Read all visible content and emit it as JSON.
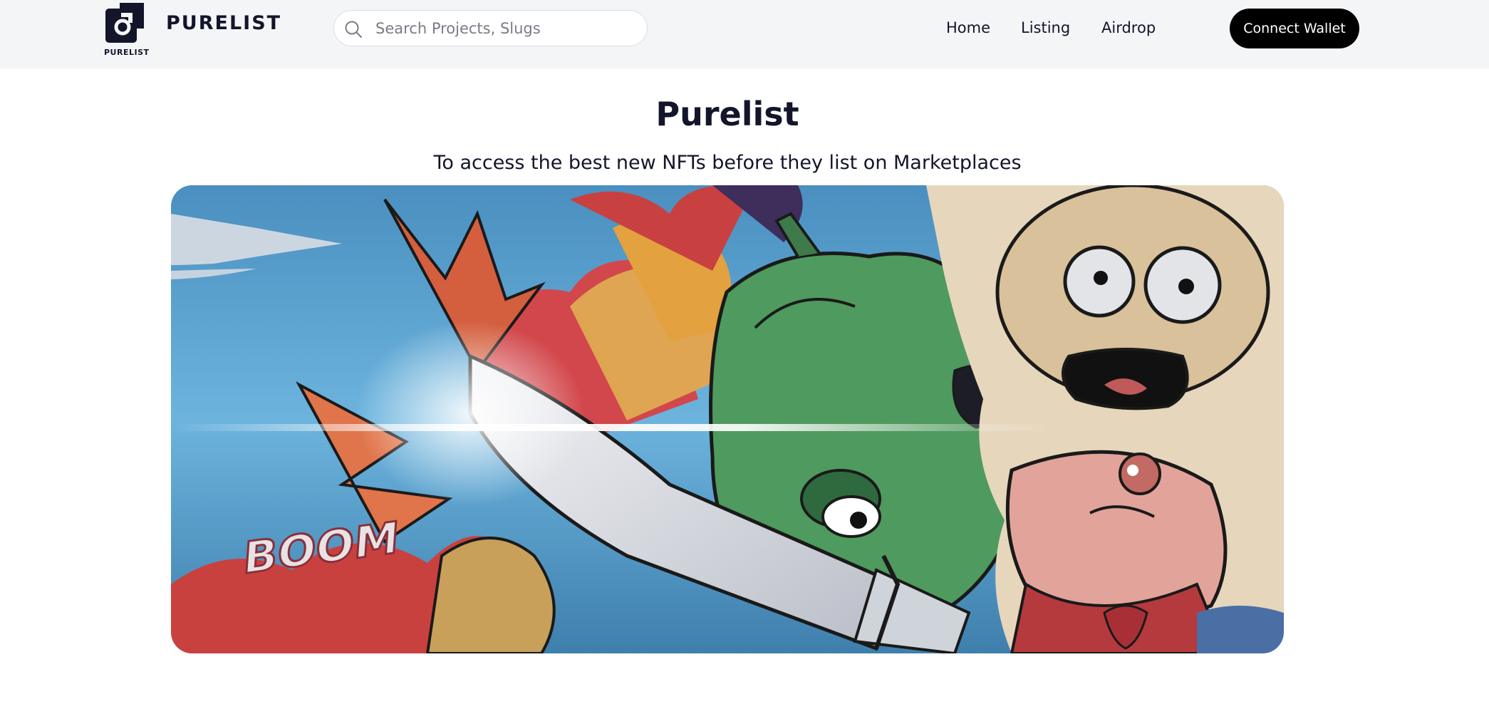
{
  "header": {
    "logo_word": "PURELIST",
    "logo_small": "PURELIST",
    "search": {
      "placeholder": "Search Projects, Slugs",
      "value": ""
    },
    "nav": [
      {
        "label": "Home"
      },
      {
        "label": "Listing"
      },
      {
        "label": "Airdrop"
      }
    ],
    "connect_label": "Connect Wallet"
  },
  "hero": {
    "title": "Purelist",
    "subtitle": "To access the best new NFTs before they list on Marketplaces",
    "banner": {
      "sfx_text": "BOOM",
      "colors": {
        "sky": "#5fa8d6",
        "pepper": "#4f9a5e",
        "explosion": "#c9413f",
        "flame": "#e3a13f"
      },
      "icons": [
        "knife",
        "green-pepper",
        "chef-character",
        "explosion"
      ]
    }
  }
}
